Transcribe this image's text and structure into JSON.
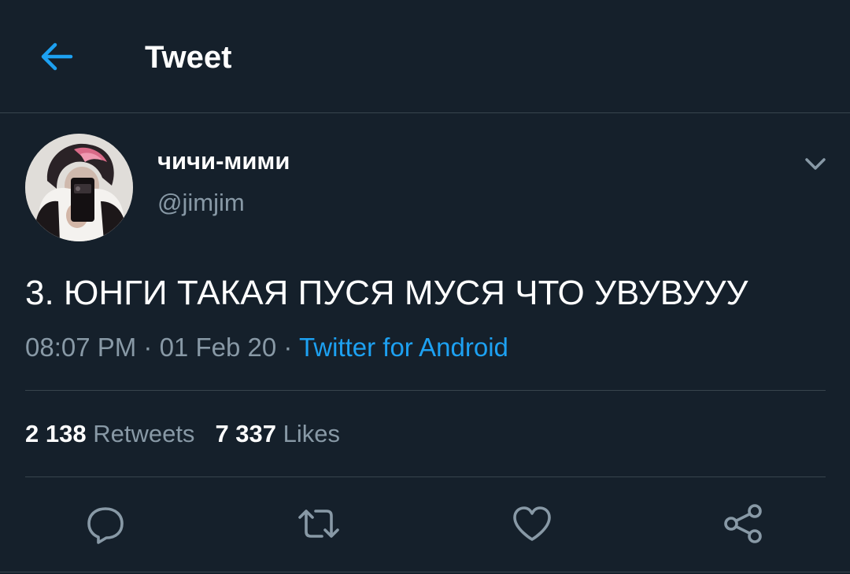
{
  "header": {
    "title": "Tweet",
    "back_icon": "arrow-left-icon"
  },
  "author": {
    "display_name": "чичи-мими",
    "handle": "@jimjim"
  },
  "tweet": {
    "text": "3. ЮНГИ ТАКАЯ ПУСЯ МУСЯ ЧТО УВУВУУУ",
    "time": "08:07 PM",
    "separator": " · ",
    "date": "01 Feb 20",
    "source": "Twitter for Android"
  },
  "stats": {
    "retweets_count": "2 138",
    "retweets_label": "Retweets",
    "likes_count": "7 337",
    "likes_label": "Likes"
  },
  "actions": [
    "reply-icon",
    "retweet-icon",
    "like-icon",
    "share-icon"
  ],
  "colors": {
    "background": "#15202b",
    "accent": "#1da1f2",
    "secondary_text": "#8899a6",
    "divider": "#38444d"
  }
}
